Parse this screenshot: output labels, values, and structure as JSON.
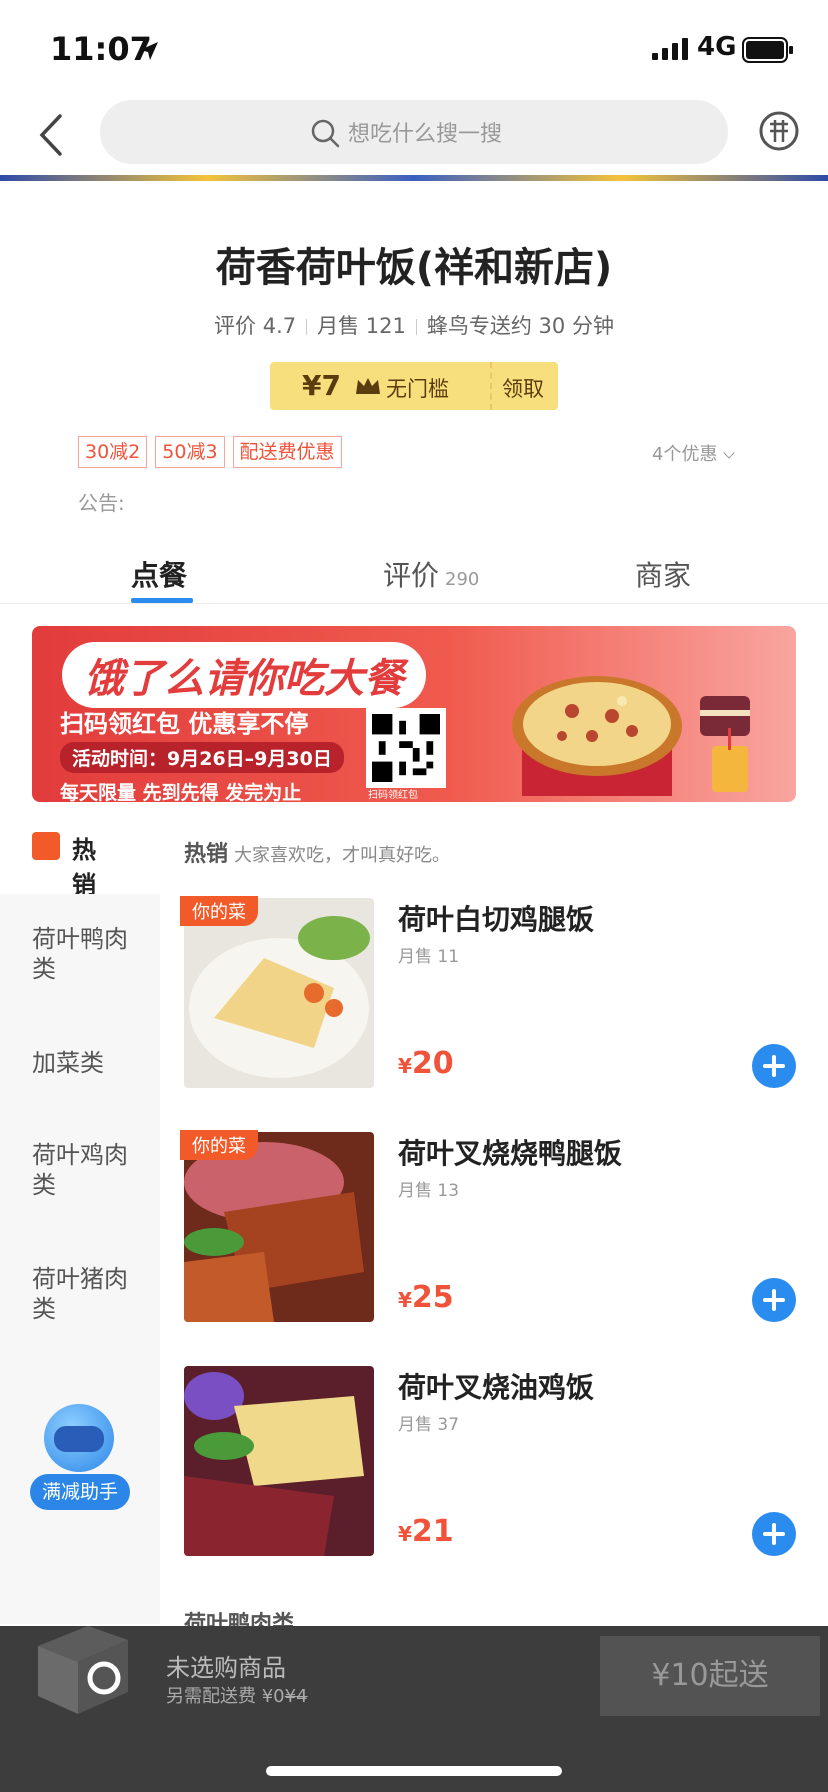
{
  "status_bar": {
    "time": "11:07",
    "network": "4G"
  },
  "search": {
    "placeholder": "想吃什么搜一搜"
  },
  "shop": {
    "name": "荷香荷叶饭(祥和新店)",
    "rating": "评价 4.7",
    "monthly_sales": "月售 121",
    "delivery": "蜂鸟专送约 30 分钟"
  },
  "coupon": {
    "amount": "¥7",
    "label": "无门槛",
    "action": "领取"
  },
  "promos": [
    "30减2",
    "50减3",
    "配送费优惠"
  ],
  "promo_more": "4个优惠",
  "notice": "公告:",
  "tabs": [
    {
      "label": "点餐"
    },
    {
      "label": "评价",
      "count": "290"
    },
    {
      "label": "商家"
    }
  ],
  "ad": {
    "title": "饿了么请你吃大餐",
    "subtitle": "扫码领红包  优惠享不停",
    "time": "活动时间：9月26日–9月30日",
    "footer": "每天限量  先到先得  发完为止",
    "qr_caption": "扫码领红包"
  },
  "hot": {
    "label": "热销",
    "section_title": "热销",
    "section_desc": "大家喜欢吃，才叫真好吃。"
  },
  "sidebar": {
    "items": [
      {
        "label": "荷叶鸭肉类"
      },
      {
        "label": "加菜类"
      },
      {
        "label": "荷叶鸡肉类"
      },
      {
        "label": "荷叶猪肉类"
      }
    ]
  },
  "helper": {
    "label": "满减助手"
  },
  "dishes": [
    {
      "tag": "你的菜",
      "name": "荷叶白切鸡腿饭",
      "sales": "月售 11",
      "currency": "¥",
      "price": "20"
    },
    {
      "tag": "你的菜",
      "name": "荷叶叉烧烧鸭腿饭",
      "sales": "月售 13",
      "currency": "¥",
      "price": "25"
    },
    {
      "tag": "",
      "name": "荷叶叉烧油鸡饭",
      "sales": "月售 37",
      "currency": "¥",
      "price": "21"
    }
  ],
  "next_section": "荷叶鸭肉类",
  "cart": {
    "status": "未选购商品",
    "fee_prefix": "另需配送费 ¥0",
    "fee_original": "¥4",
    "min_order": "¥10起送"
  },
  "colors": {
    "accent": "#2b8cf0",
    "price": "#f0533a",
    "coupon": "#f8df7d",
    "tag": "#f25a29"
  }
}
